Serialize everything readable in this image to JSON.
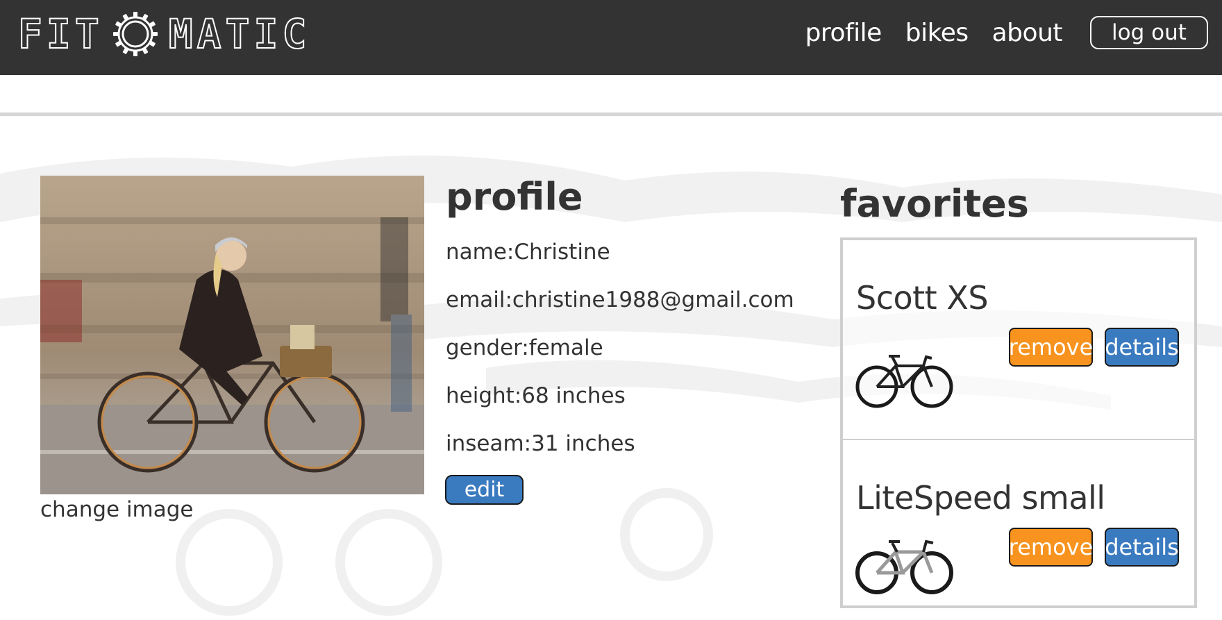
{
  "brand": {
    "logo_left": "FIT",
    "logo_right": "MATIC"
  },
  "nav": {
    "items": [
      {
        "label": "profile"
      },
      {
        "label": "bikes"
      },
      {
        "label": "about"
      }
    ],
    "logout_label": "log out"
  },
  "photo": {
    "change_label": "change image"
  },
  "profile": {
    "title": "profile",
    "fields": [
      {
        "text": "name:Christine"
      },
      {
        "text": "email:christine1988@gmail.com"
      },
      {
        "text": "gender:female"
      },
      {
        "text": "height:68 inches"
      },
      {
        "text": "inseam:31 inches"
      }
    ],
    "edit_label": "edit"
  },
  "favorites": {
    "title": "favorites",
    "items": [
      {
        "name": "Scott XS",
        "remove_label": "remove",
        "details_label": "details"
      },
      {
        "name": "LiteSpeed small",
        "remove_label": "remove",
        "details_label": "details"
      }
    ]
  },
  "colors": {
    "header_bg": "#333333",
    "remove": "#f7931e",
    "details": "#3a7abf",
    "edit": "#3a7abf"
  }
}
